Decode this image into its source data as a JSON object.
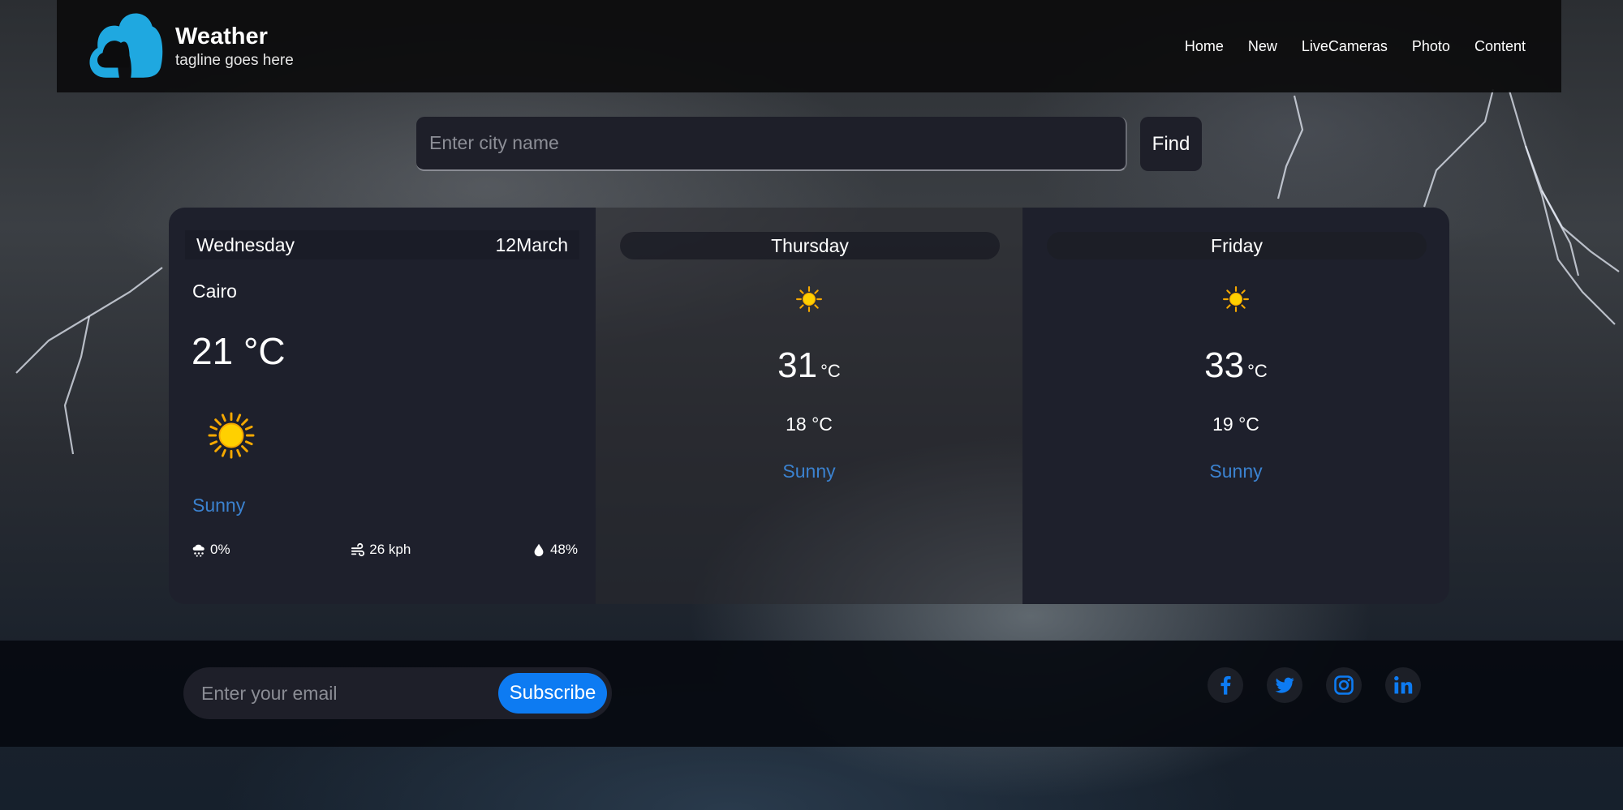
{
  "header": {
    "title": "Weather",
    "tagline": "tagline goes here",
    "nav": [
      "Home",
      "New",
      "LiveCameras",
      "Photo",
      "Content"
    ]
  },
  "search": {
    "placeholder": "Enter city name",
    "value": "",
    "button_label": "Find"
  },
  "forecast": {
    "today": {
      "day": "Wednesday",
      "date": "12March",
      "city": "Cairo",
      "temp": "21 °C",
      "icon": "sun-icon",
      "condition": "Sunny",
      "rain": "0%",
      "wind": "26 kph",
      "humidity": "48%"
    },
    "next": [
      {
        "day": "Thursday",
        "icon": "sun-icon",
        "max": "31",
        "unit": "°C",
        "min": "18 °C",
        "condition": "Sunny"
      },
      {
        "day": "Friday",
        "icon": "sun-icon",
        "max": "33",
        "unit": "°C",
        "min": "19 °C",
        "condition": "Sunny"
      }
    ]
  },
  "footer": {
    "email_placeholder": "Enter your email",
    "subscribe_label": "Subscribe",
    "socials": [
      "facebook-icon",
      "twitter-icon",
      "instagram-icon",
      "linkedin-icon"
    ]
  },
  "colors": {
    "accent": "#0d7bf2",
    "condition_text": "#3b82d0",
    "card_bg": "#1e202c",
    "logo": "#1fa8e0"
  }
}
